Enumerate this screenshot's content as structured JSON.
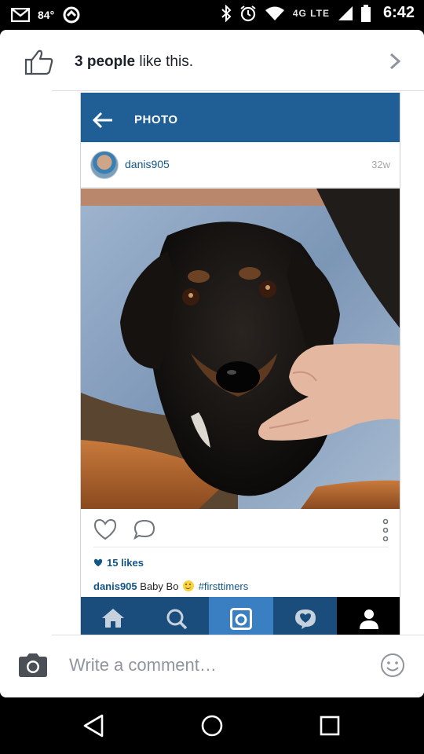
{
  "status_bar": {
    "temperature": "84°",
    "network": "4G LTE",
    "time": "6:42",
    "icons": [
      "gmail-icon",
      "weather-icon",
      "bluetooth-icon",
      "alarm-icon",
      "wifi-icon",
      "signal-icon",
      "battery-icon"
    ]
  },
  "likes_bar": {
    "count_bold": "3 people",
    "suffix": " like this.",
    "icon": "thumbs-up-icon"
  },
  "instagram_post": {
    "header_title": "PHOTO",
    "username": "danis905",
    "age": "32w",
    "likes": "15 likes",
    "caption_user": "danis905",
    "caption_text": "Baby Bo",
    "caption_hashtag": "#firsttimers",
    "photo_description": "black and brown puppy held by a hand on jeans",
    "nav_tabs": [
      "home-icon",
      "search-icon",
      "camera-icon",
      "activity-icon",
      "profile-icon"
    ],
    "colors": {
      "header": "#1f5f96",
      "link": "#125688",
      "active_tab": "#3a7fc1"
    }
  },
  "comment_bar": {
    "placeholder": "Write a comment…"
  },
  "nav_bar": {
    "buttons": [
      "back-icon",
      "home-icon",
      "recents-icon"
    ]
  }
}
